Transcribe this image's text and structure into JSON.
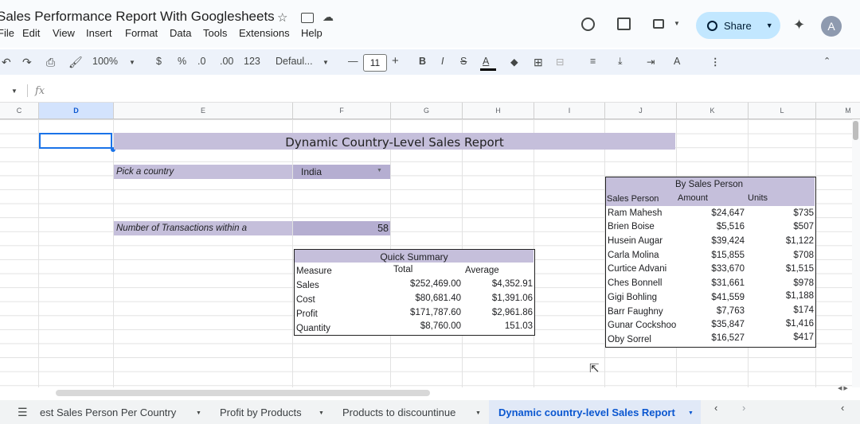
{
  "doc": {
    "title": "Sales Performance Report With Googlesheets"
  },
  "menu": [
    "File",
    "Edit",
    "View",
    "Insert",
    "Format",
    "Data",
    "Tools",
    "Extensions",
    "Help"
  ],
  "share": {
    "label": "Share"
  },
  "avatar": {
    "initial": "A"
  },
  "toolbar": {
    "zoom": "100%",
    "currency": "$",
    "percent": "%",
    "dec_less": ".0",
    "dec_more": ".00",
    "number_format": "123",
    "font": "Defaul...",
    "font_size": "11",
    "bold": "B",
    "italic": "I",
    "text_color": "A"
  },
  "formula": {
    "fx": "fx"
  },
  "columns": [
    "C",
    "D",
    "E",
    "F",
    "G",
    "H",
    "I",
    "J",
    "K",
    "L",
    "M"
  ],
  "report": {
    "title": "Dynamic Country-Level Sales Report",
    "pick_label": "Pick a country",
    "pick_value": "India",
    "transactions_label": "Number of Transactions within a",
    "transactions_value": "58"
  },
  "quick_summary": {
    "title": "Quick Summary",
    "headers": [
      "Measure",
      "Total",
      "Average"
    ],
    "rows": [
      {
        "measure": "Sales",
        "total": "$252,469.00",
        "average": "$4,352.91"
      },
      {
        "measure": "Cost",
        "total": "$80,681.40",
        "average": "$1,391.06"
      },
      {
        "measure": "Profit",
        "total": "$171,787.60",
        "average": "$2,961.86"
      },
      {
        "measure": "Quantity",
        "total": "$8,760.00",
        "average": "151.03"
      }
    ]
  },
  "by_sales_person": {
    "title": "By Sales Person",
    "headers": [
      "Sales Person",
      "Amount",
      "Units"
    ],
    "rows": [
      {
        "name": "Ram Mahesh",
        "amount": "$24,647",
        "units": "$735"
      },
      {
        "name": "Brien Boise",
        "amount": "$5,516",
        "units": "$507"
      },
      {
        "name": "Husein Augar",
        "amount": "$39,424",
        "units": "$1,122"
      },
      {
        "name": "Carla Molina",
        "amount": "$15,855",
        "units": "$708"
      },
      {
        "name": "Curtice Advani",
        "amount": "$33,670",
        "units": "$1,515"
      },
      {
        "name": "Ches Bonnell",
        "amount": "$31,661",
        "units": "$978"
      },
      {
        "name": "Gigi Bohling",
        "amount": "$41,559",
        "units": "$1,188"
      },
      {
        "name": "Barr Faughny",
        "amount": "$7,763",
        "units": "$174"
      },
      {
        "name": "Gunar Cockshoo",
        "amount": "$35,847",
        "units": "$1,416"
      },
      {
        "name": "Oby Sorrel",
        "amount": "$16,527",
        "units": "$417"
      }
    ]
  },
  "sheets": [
    {
      "label": "est Sales Person Per Country"
    },
    {
      "label": "Profit by Products"
    },
    {
      "label": "Products to discountinue"
    },
    {
      "label": "Dynamic country-level Sales Report"
    }
  ]
}
